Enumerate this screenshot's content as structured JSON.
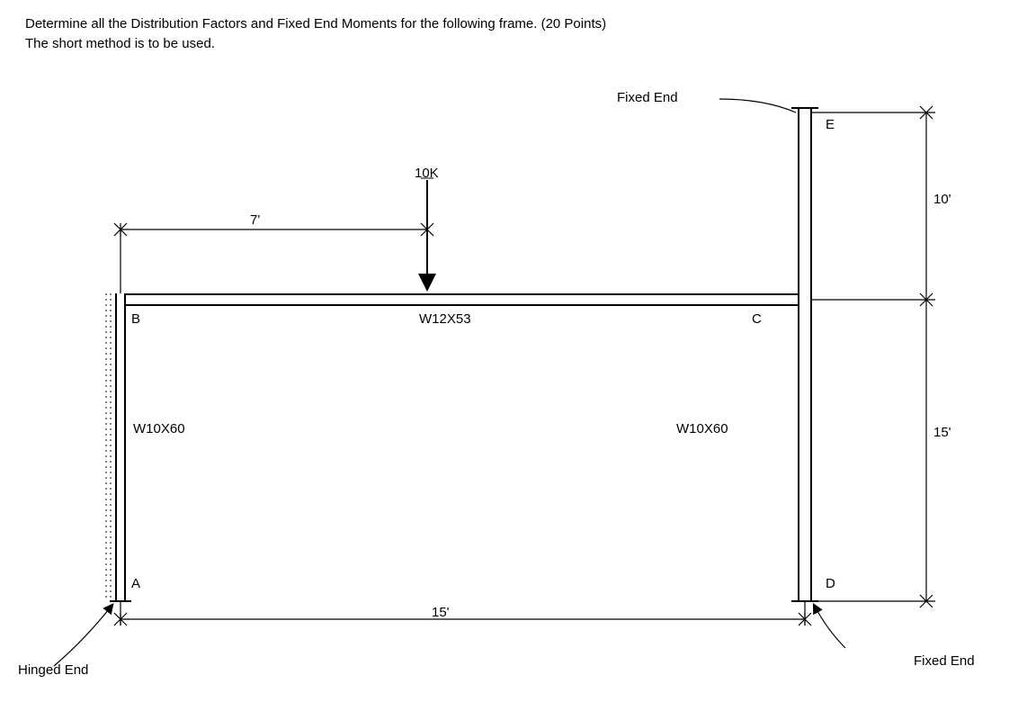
{
  "problem": {
    "line1": "Determine all the Distribution Factors and Fixed End Moments for the following frame.  (20 Points)",
    "line2": "The short method is to be used."
  },
  "labels": {
    "fixed_end_top": "Fixed End",
    "fixed_end_bottom": "Fixed End",
    "hinged_end": "Hinged End",
    "A": "A",
    "B": "B",
    "C": "C",
    "D": "D",
    "E": "E"
  },
  "members": {
    "beam": "W12X53",
    "col_left": "W10X60",
    "col_right": "W10X60"
  },
  "load": {
    "magnitude": "10K"
  },
  "dims": {
    "load_offset": "7'",
    "dim_10": "10'",
    "dim_15_right": "15'",
    "span": "15'"
  }
}
